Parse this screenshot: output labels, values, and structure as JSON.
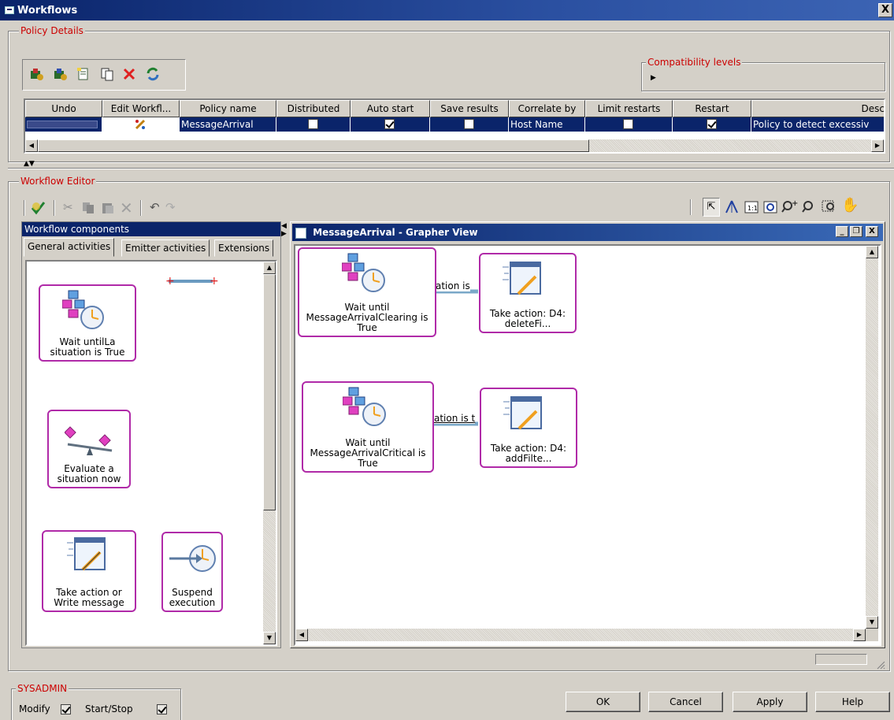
{
  "window": {
    "title": "Workflows",
    "close_label": "X"
  },
  "policy_details": {
    "label": "Policy Details",
    "compat_label": "Compatibility levels",
    "columns": [
      "Undo",
      "Edit Workfl...",
      "Policy name",
      "Distributed",
      "Auto start",
      "Save results",
      "Correlate by",
      "Limit restarts",
      "Restart",
      "Desc"
    ],
    "row": {
      "policy_name": "MessageArrival",
      "distributed": false,
      "auto_start": true,
      "save_results": false,
      "correlate_by": "Host Name",
      "limit_restarts": false,
      "restart": true,
      "description": "Policy to detect excessiv"
    }
  },
  "workflow_editor": {
    "label": "Workflow Editor",
    "components_title": "Workflow components",
    "tabs": [
      "General activities",
      "Emitter activities",
      "Extensions"
    ],
    "palette": [
      {
        "label": "Wait untilLa situation is True"
      },
      {
        "label": "Evaluate a situation now"
      },
      {
        "label": "Take action or Write message"
      },
      {
        "label": "Suspend execution"
      }
    ],
    "grapher_title": "MessageArrival - Grapher View",
    "nodes": [
      {
        "label": "Wait until MessageArrivalClearing is True"
      },
      {
        "label": "Take action: D4: deleteFi..."
      },
      {
        "label": "Wait until MessageArrivalCritical is True"
      },
      {
        "label": "Take action: D4: addFilte..."
      }
    ],
    "edges": [
      {
        "label": "ation is"
      },
      {
        "label": "ation is t"
      }
    ]
  },
  "sysadmin": {
    "label": "SYSADMIN",
    "modify_label": "Modify",
    "startstop_label": "Start/Stop"
  },
  "buttons": {
    "ok": "OK",
    "cancel": "Cancel",
    "apply": "Apply",
    "help": "Help"
  }
}
